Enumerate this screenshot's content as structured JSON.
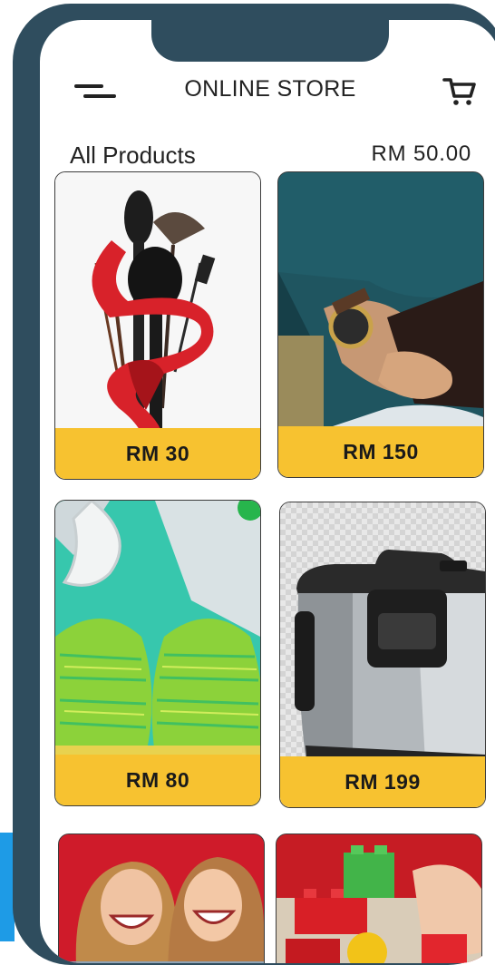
{
  "header": {
    "title": "ONLINE STORE",
    "menu_icon": "hamburger-menu-icon",
    "cart_icon": "shopping-cart-icon"
  },
  "section": {
    "title": "All Products",
    "balance": "RM 50.00"
  },
  "products": [
    {
      "name": "makeup-brushes",
      "price": "RM 30"
    },
    {
      "name": "wrist-watch",
      "price": "RM 150"
    },
    {
      "name": "green-sneakers",
      "price": "RM 80"
    },
    {
      "name": "rice-cooker",
      "price": "RM 199"
    },
    {
      "name": "smiling-girls",
      "price": ""
    },
    {
      "name": "toy-blocks",
      "price": ""
    }
  ],
  "colors": {
    "frame": "#2f4d5e",
    "price_bar": "#f7c230",
    "text": "#222222"
  }
}
